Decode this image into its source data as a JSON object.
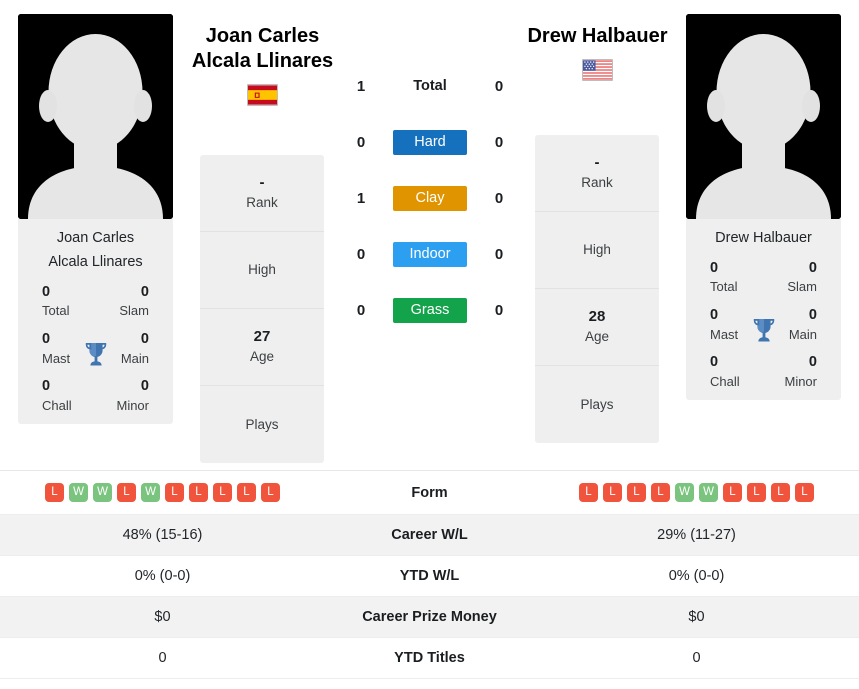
{
  "colors": {
    "hard": "#1570bd",
    "clay": "#e09400",
    "indoor": "#2c9ff0",
    "grass": "#13a34a",
    "win": "#7bc47f",
    "loss": "#f0543c",
    "trophy": "#4175b0",
    "panel": "#efefef"
  },
  "players": {
    "left": {
      "name_line1": "Joan Carles",
      "name_line2": "Alcala Llinares",
      "country": "Spain",
      "flag": "es-flag",
      "caption_line1": "Joan Carles",
      "caption_line2": "Alcala Llinares",
      "titles": [
        {
          "value": "0",
          "label": "Total"
        },
        {
          "value": "0",
          "label": "Slam"
        },
        {
          "value": "0",
          "label": "Mast"
        },
        {
          "value": "0",
          "label": "Main"
        },
        {
          "value": "0",
          "label": "Chall"
        },
        {
          "value": "0",
          "label": "Minor"
        }
      ],
      "info": [
        {
          "value": "-",
          "label": "Rank"
        },
        {
          "value": "",
          "label": "High"
        },
        {
          "value": "27",
          "label": "Age"
        },
        {
          "value": "",
          "label": "Plays"
        }
      ],
      "form": [
        "L",
        "W",
        "W",
        "L",
        "W",
        "L",
        "L",
        "L",
        "L",
        "L"
      ]
    },
    "right": {
      "name_line1": "Drew Halbauer",
      "name_line2": "",
      "country": "United States",
      "flag": "us-flag",
      "caption_line1": "Drew Halbauer",
      "caption_line2": "",
      "titles": [
        {
          "value": "0",
          "label": "Total"
        },
        {
          "value": "0",
          "label": "Slam"
        },
        {
          "value": "0",
          "label": "Mast"
        },
        {
          "value": "0",
          "label": "Main"
        },
        {
          "value": "0",
          "label": "Chall"
        },
        {
          "value": "0",
          "label": "Minor"
        }
      ],
      "info": [
        {
          "value": "-",
          "label": "Rank"
        },
        {
          "value": "",
          "label": "High"
        },
        {
          "value": "28",
          "label": "Age"
        },
        {
          "value": "",
          "label": "Plays"
        }
      ],
      "form": [
        "L",
        "L",
        "L",
        "L",
        "W",
        "W",
        "L",
        "L",
        "L",
        "L"
      ]
    }
  },
  "surfaces": [
    {
      "label": "Total",
      "left": "1",
      "right": "0",
      "style": "plain"
    },
    {
      "label": "Hard",
      "left": "0",
      "right": "0",
      "style": "hard"
    },
    {
      "label": "Clay",
      "left": "1",
      "right": "0",
      "style": "clay"
    },
    {
      "label": "Indoor",
      "left": "0",
      "right": "0",
      "style": "indoor"
    },
    {
      "label": "Grass",
      "left": "0",
      "right": "0",
      "style": "grass"
    }
  ],
  "stats_rows": [
    {
      "label": "Form",
      "left": "",
      "right": "",
      "type": "form"
    },
    {
      "label": "Career W/L",
      "left": "48% (15-16)",
      "right": "29% (11-27)",
      "type": "text"
    },
    {
      "label": "YTD W/L",
      "left": "0% (0-0)",
      "right": "0% (0-0)",
      "type": "text"
    },
    {
      "label": "Career Prize Money",
      "left": "$0",
      "right": "$0",
      "type": "text"
    },
    {
      "label": "YTD Titles",
      "left": "0",
      "right": "0",
      "type": "text"
    }
  ]
}
